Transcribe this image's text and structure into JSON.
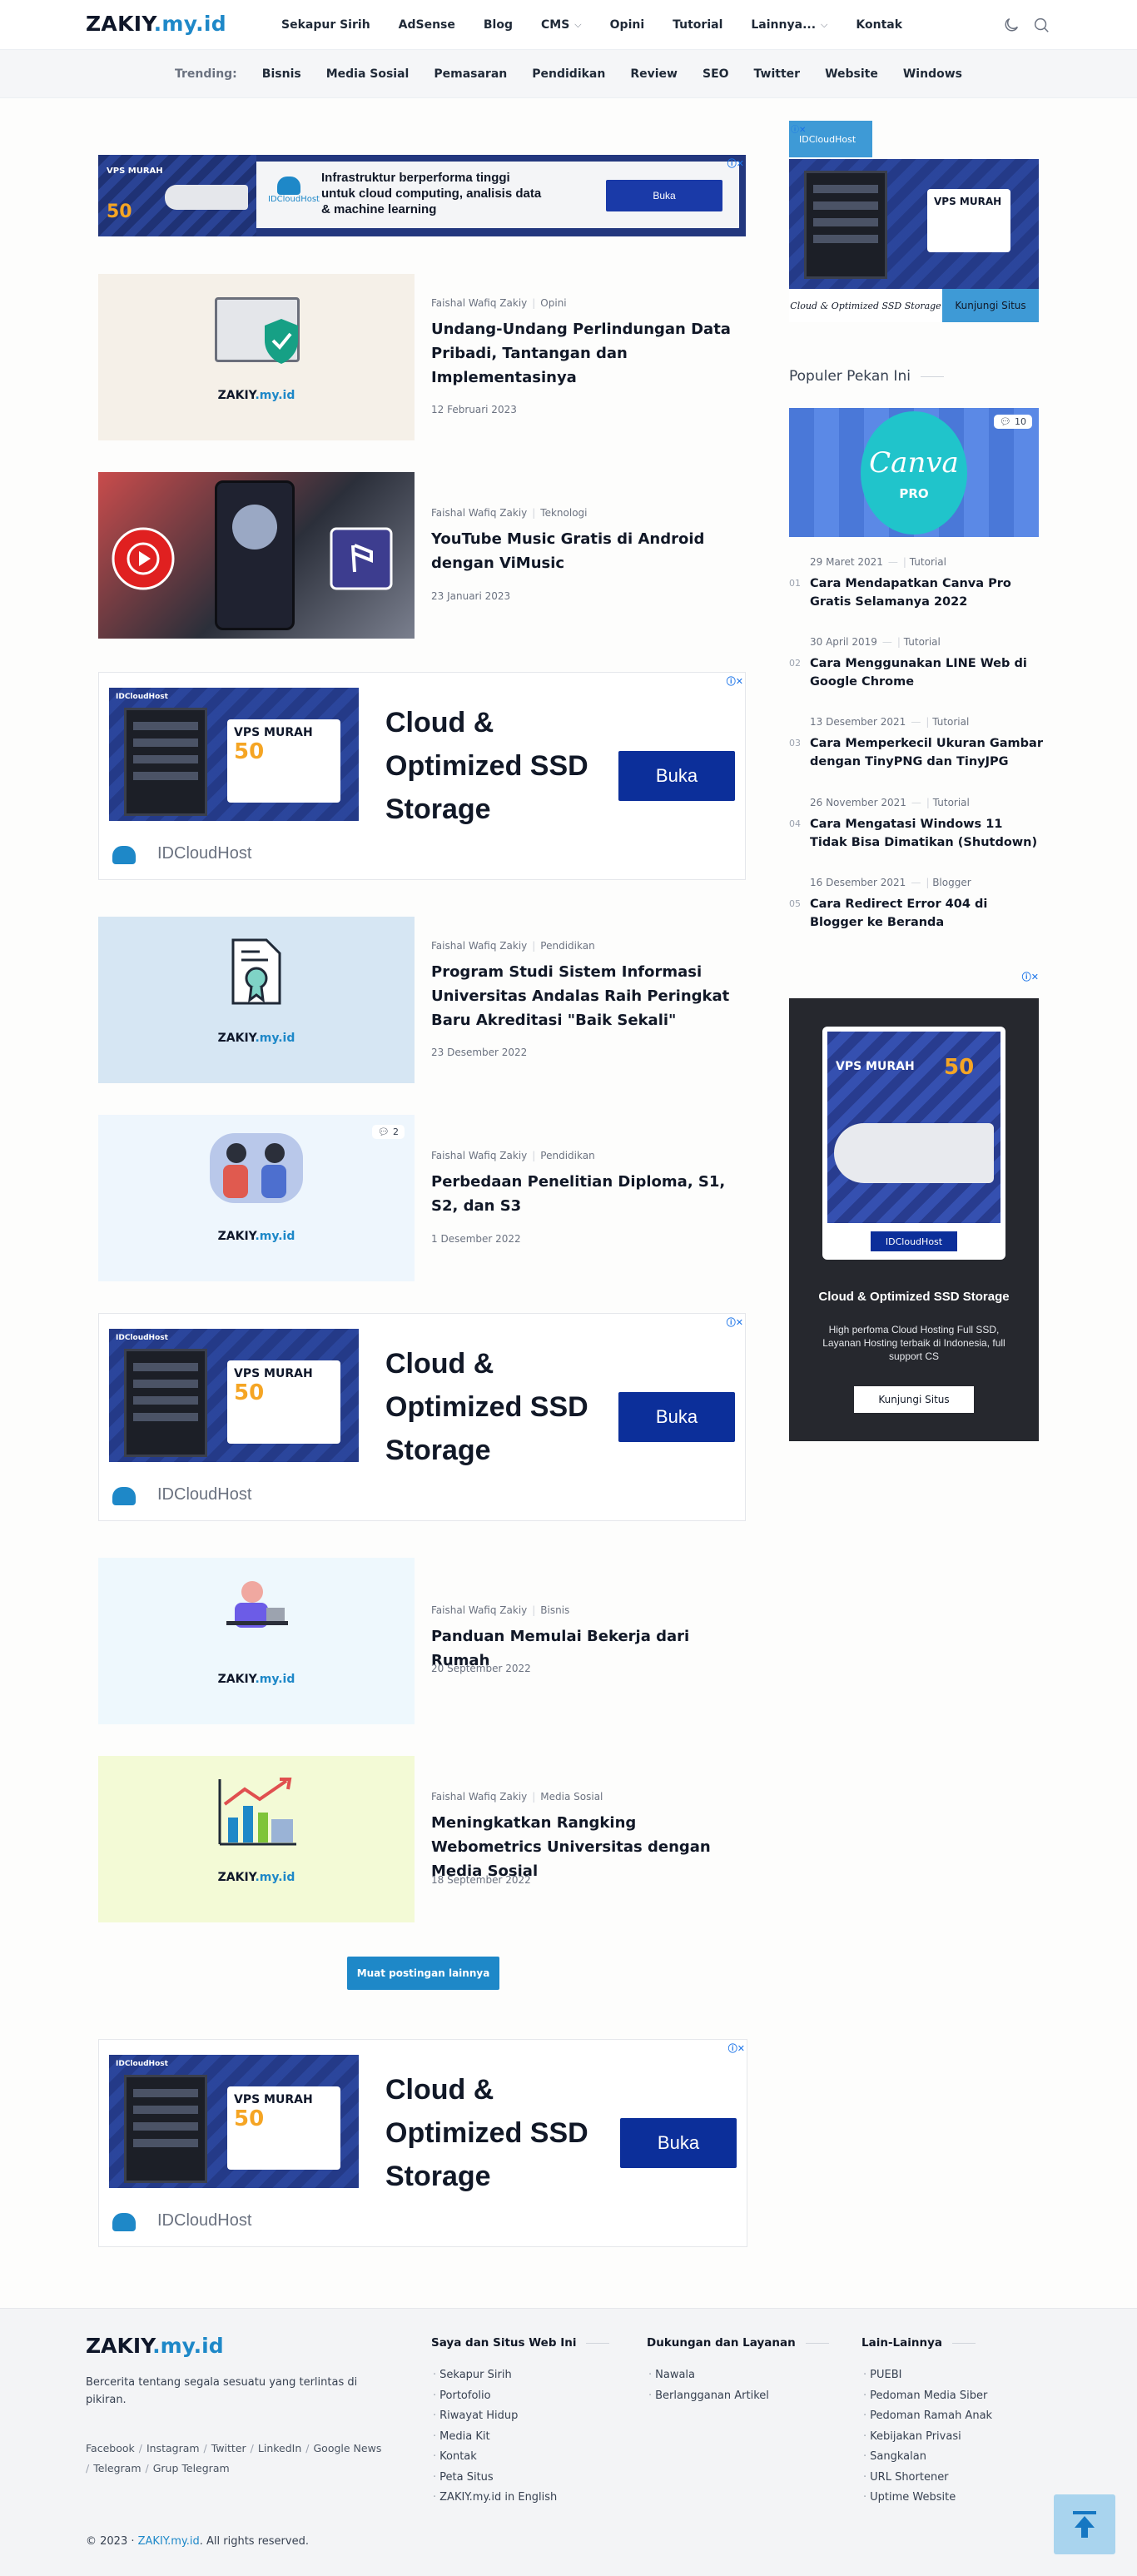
{
  "header": {
    "logo_main": "ZAKIY",
    "logo_tld": ".my.id",
    "nav": [
      "Sekapur Sirih",
      "AdSense",
      "Blog",
      "CMS",
      "Opini",
      "Tutorial",
      "Lainnya...",
      "Kontak"
    ]
  },
  "trending": {
    "label": "Trending:",
    "items": [
      "Bisnis",
      "Media Sosial",
      "Pemasaran",
      "Pendidikan",
      "Review",
      "SEO",
      "Twitter",
      "Website",
      "Windows"
    ]
  },
  "ads": {
    "banner_brand": "IDCloudHost",
    "banner_vps": "VPS MURAH",
    "banner_price": "50",
    "banner_text": "Infrastruktur berperforma tinggi untuk cloud computing, analisis data & machine learning",
    "banner_button": "Buka",
    "card_heading": "Cloud & Optimized SSD Storage",
    "card_button": "Buka",
    "card_brand": "IDCloudHost",
    "card_vps": "VPS MURAH",
    "card_price": "50",
    "sidebar_tag": "IDCloudHost",
    "sidebar_caption": "Cloud & Optimized SSD Storage",
    "sidebar_button": "Kunjungi Situs",
    "sidebar_vps": "VPS MURAH",
    "skyscraper_vps": "VPS MURAH",
    "skyscraper_price": "50",
    "skyscraper_brand": "IDCloudHost",
    "skyscraper_title": "Cloud & Optimized SSD Storage",
    "skyscraper_desc": "High perfoma Cloud Hosting Full SSD, Layanan Hosting terbaik di Indonesia, full support CS",
    "skyscraper_button": "Kunjungi Situs"
  },
  "posts": [
    {
      "author": "Faishal Wafiq Zakiy",
      "category": "Opini",
      "title": "Undang-Undang Perlindungan Data Pribadi, Tantangan dan Implementasinya",
      "date": "12 Februari 2023",
      "watermark_main": "ZAKIY",
      "watermark_tld": ".my.id"
    },
    {
      "author": "Faishal Wafiq Zakiy",
      "category": "Teknologi",
      "title": "YouTube Music Gratis di Android dengan ViMusic",
      "date": "23 Januari 2023"
    },
    {
      "author": "Faishal Wafiq Zakiy",
      "category": "Pendidikan",
      "title": "Program Studi Sistem Informasi Universitas Andalas Raih Peringkat Baru Akreditasi \"Baik Sekali\"",
      "date": "23 Desember 2022",
      "watermark_main": "ZAKIY",
      "watermark_tld": ".my.id"
    },
    {
      "author": "Faishal Wafiq Zakiy",
      "category": "Pendidikan",
      "title": "Perbedaan Penelitian Diploma, S1, S2, dan S3",
      "date": "1 Desember 2022",
      "comments": "2",
      "watermark_main": "ZAKIY",
      "watermark_tld": ".my.id"
    },
    {
      "author": "Faishal Wafiq Zakiy",
      "category": "Bisnis",
      "title": "Panduan Memulai Bekerja dari Rumah",
      "date": "20 September 2022",
      "watermark_main": "ZAKIY",
      "watermark_tld": ".my.id"
    },
    {
      "author": "Faishal Wafiq Zakiy",
      "category": "Media Sosial",
      "title": "Meningkatkan Rangking Webometrics Universitas dengan Media Sosial",
      "date": "18 September 2022",
      "watermark_main": "ZAKIY",
      "watermark_tld": ".my.id"
    }
  ],
  "load_more": "Muat postingan lainnya",
  "popular": {
    "title": "Populer Pekan Ini",
    "hero_comments": "10",
    "hero_text_1": "Canva",
    "hero_text_2": "PRO",
    "items": [
      {
        "num": "01",
        "date": "29 Maret 2021",
        "category": "Tutorial",
        "title": "Cara Mendapatkan Canva Pro Gratis Selamanya 2022"
      },
      {
        "num": "02",
        "date": "30 April 2019",
        "category": "Tutorial",
        "title": "Cara Menggunakan LINE Web di Google Chrome"
      },
      {
        "num": "03",
        "date": "13 Desember 2021",
        "category": "Tutorial",
        "title": "Cara Memperkecil Ukuran Gambar dengan TinyPNG dan TinyJPG"
      },
      {
        "num": "04",
        "date": "26 November 2021",
        "category": "Tutorial",
        "title": "Cara Mengatasi Windows 11 Tidak Bisa Dimatikan (Shutdown)"
      },
      {
        "num": "05",
        "date": "16 Desember 2021",
        "category": "Blogger",
        "title": "Cara Redirect Error 404 di Blogger ke Beranda"
      }
    ]
  },
  "footer": {
    "logo_main": "ZAKIY",
    "logo_tld": ".my.id",
    "description": "Bercerita tentang segala sesuatu yang terlintas di pikiran.",
    "social": [
      "Facebook",
      "Instagram",
      "Twitter",
      "LinkedIn",
      "Google News",
      "Telegram",
      "Grup Telegram"
    ],
    "col1_title": "Saya dan Situs Web Ini",
    "col1": [
      "Sekapur Sirih",
      "Portofolio",
      "Riwayat Hidup",
      "Media Kit",
      "Kontak",
      "Peta Situs",
      "ZAKIY.my.id in English"
    ],
    "col2_title": "Dukungan dan Layanan",
    "col2": [
      "Nawala",
      "Berlangganan Artikel"
    ],
    "col3_title": "Lain-Lainnya",
    "col3": [
      "PUEBI",
      "Pedoman Media Siber",
      "Pedoman Ramah Anak",
      "Kebijakan Privasi",
      "Sangkalan",
      "URL Shortener",
      "Uptime Website"
    ],
    "copy_prefix": "© 2023 · ",
    "copy_link": "ZAKIY.my.id",
    "copy_suffix": ". All rights reserved."
  }
}
